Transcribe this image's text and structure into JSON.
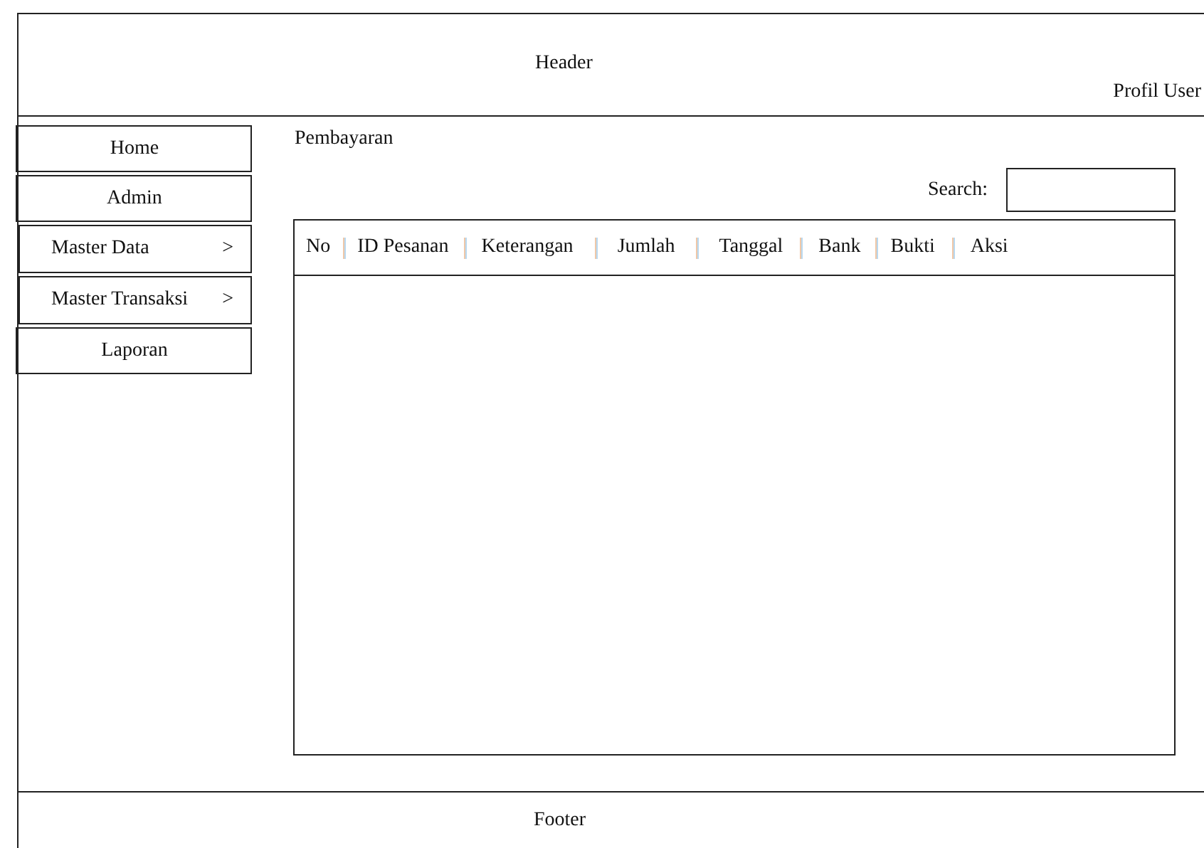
{
  "header": {
    "title": "Header",
    "profile": "Profil User"
  },
  "sidebar": {
    "items": [
      {
        "label": "Home",
        "kind": "link"
      },
      {
        "label": "Admin",
        "kind": "link"
      },
      {
        "label": "Master Data",
        "kind": "submenu",
        "arrow": ">"
      },
      {
        "label": "Master Transaksi",
        "kind": "submenu",
        "arrow": ">"
      },
      {
        "label": "Laporan",
        "kind": "link"
      }
    ]
  },
  "page_title": "Pembayaran",
  "search": {
    "label": "Search:"
  },
  "table": {
    "columns": [
      "No",
      "ID Pesanan",
      "Keterangan",
      "Jumlah",
      "Tanggal",
      "Bank",
      "Bukti",
      "Aksi"
    ]
  },
  "footer": {
    "text": "Footer"
  }
}
